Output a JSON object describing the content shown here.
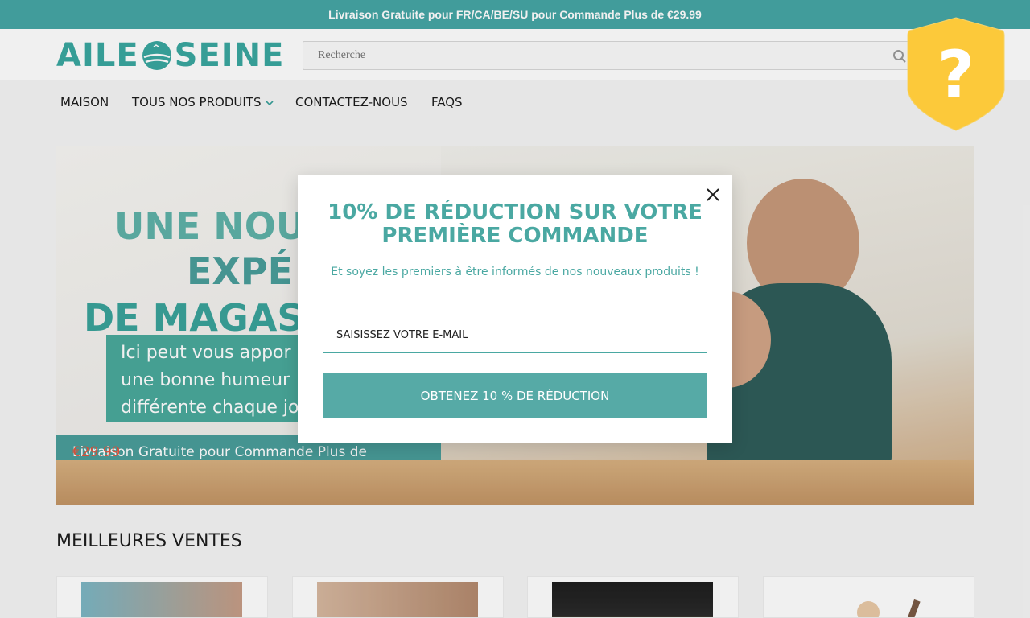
{
  "announcement": {
    "text": "Livraison Gratuite pour FR/CA/BE/SU pour Commande Plus de €29.99"
  },
  "header": {
    "logo_text_left": "AILE",
    "logo_text_right": "SEINE",
    "search": {
      "placeholder": "Recherche",
      "icon": "search-icon"
    }
  },
  "nav": {
    "items": [
      {
        "label": "MAISON"
      },
      {
        "label": "TOUS NOS PRODUITS",
        "icon": "chevron-down-icon"
      },
      {
        "label": "CONTACTEZ-NOUS"
      },
      {
        "label": "FAQS"
      }
    ]
  },
  "hero": {
    "line1": "UNE NOU",
    "line2": "EXPÉ",
    "line3": "DE MAGAS",
    "sub_lines": [
      "Ici peut vous appor",
      "une bonne humeur",
      "différente chaque jo"
    ],
    "bar_text": "Livraison Gratuite pour Commande Plus de",
    "bar_price": "€29.99"
  },
  "section": {
    "title": "MEILLEURES VENTES"
  },
  "modal": {
    "title": "10% DE RÉDUCTION SUR VOTRE PREMIÈRE COMMANDE",
    "subtitle": "Et soyez les premiers à être informés de nos nouveaux produits !",
    "email_placeholder": "SAISISSEZ VOTRE E-MAIL",
    "button_label": "OBTENEZ 10 % DE RÉDUCTION",
    "close_icon": "close-icon"
  },
  "badge": {
    "icon": "question-shield-icon",
    "symbol": "?"
  },
  "colors": {
    "accent": "#46a6a5",
    "button": "#56aaa6",
    "badge": "#fcc93a",
    "hero_price": "#e5543c"
  }
}
